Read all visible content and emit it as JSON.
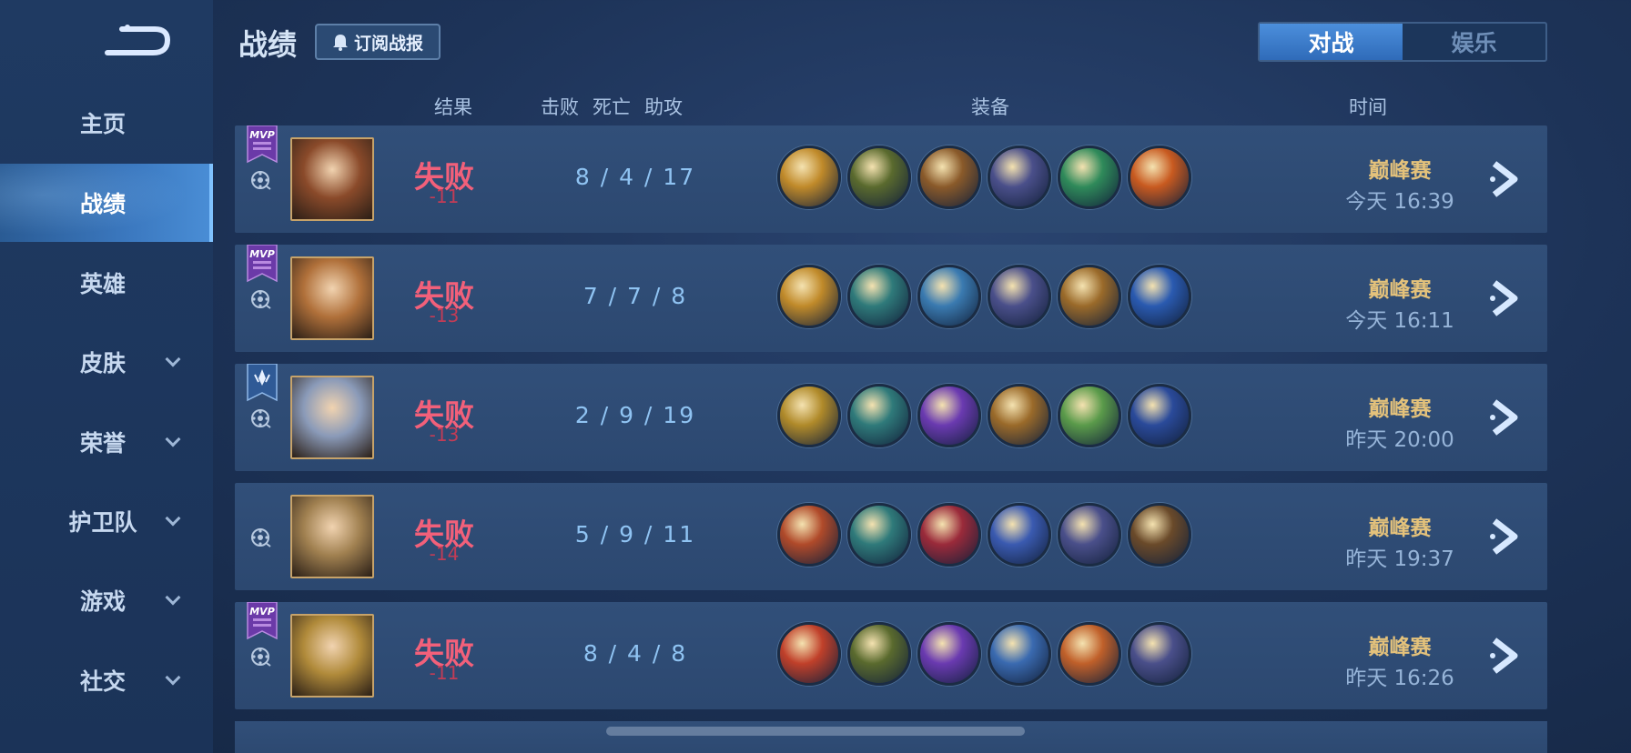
{
  "nav": {
    "items": [
      {
        "label": "主页"
      },
      {
        "label": "战绩"
      },
      {
        "label": "英雄"
      },
      {
        "label": "皮肤"
      },
      {
        "label": "荣誉"
      },
      {
        "label": "护卫队"
      },
      {
        "label": "游戏"
      },
      {
        "label": "社交"
      }
    ]
  },
  "header": {
    "title": "战绩",
    "subscribe_label": "订阅战报",
    "tabs": [
      {
        "label": "对战"
      },
      {
        "label": "娱乐"
      }
    ]
  },
  "columns": {
    "result": "结果",
    "kill": "击败",
    "death": "死亡",
    "assist": "助攻",
    "equipment": "装备",
    "time": "时间"
  },
  "matches": [
    {
      "badge": "MVP",
      "result": "失败",
      "delta": "-11",
      "kda": "8 / 4 / 17",
      "mode": "巅峰赛",
      "time": "今天 16:39",
      "equipment": [
        "#c08a2a",
        "#5a6a2e",
        "#8a5a2a",
        "#4a4f8a",
        "#2f8a5a",
        "#c85a20"
      ],
      "avatar_color": "#8a4a2a"
    },
    {
      "badge": "MVP",
      "result": "失败",
      "delta": "-13",
      "kda": "7 / 7 / 8",
      "mode": "巅峰赛",
      "time": "今天 16:11",
      "equipment": [
        "#c08a2a",
        "#2f7a7a",
        "#3a7ab0",
        "#4a4f8a",
        "#9a6a2a",
        "#2a5ab0"
      ],
      "avatar_color": "#b0703a"
    },
    {
      "badge": "glory",
      "result": "失败",
      "delta": "-13",
      "kda": "2 / 9 / 19",
      "mode": "巅峰赛",
      "time": "昨天 20:00",
      "equipment": [
        "#b08a2a",
        "#2f7a7a",
        "#6a3ab0",
        "#9a6a2a",
        "#5a9a4a",
        "#2a4a9a"
      ],
      "avatar_color": "#8a9ab8"
    },
    {
      "badge": "",
      "result": "失败",
      "delta": "-14",
      "kda": "5 / 9 / 11",
      "mode": "巅峰赛",
      "time": "昨天 19:37",
      "equipment": [
        "#b04a2a",
        "#2f7a7a",
        "#9a2a3a",
        "#3a5ab0",
        "#4a4f8a",
        "#6a4a2a"
      ],
      "avatar_color": "#a08050"
    },
    {
      "badge": "MVP",
      "result": "失败",
      "delta": "-11",
      "kda": "8 / 4 / 8",
      "mode": "巅峰赛",
      "time": "昨天 16:26",
      "equipment": [
        "#c0402a",
        "#5a6a2e",
        "#6a3ab0",
        "#3a6ab0",
        "#c0602a",
        "#4a4f8a"
      ],
      "avatar_color": "#b08a3a"
    }
  ]
}
